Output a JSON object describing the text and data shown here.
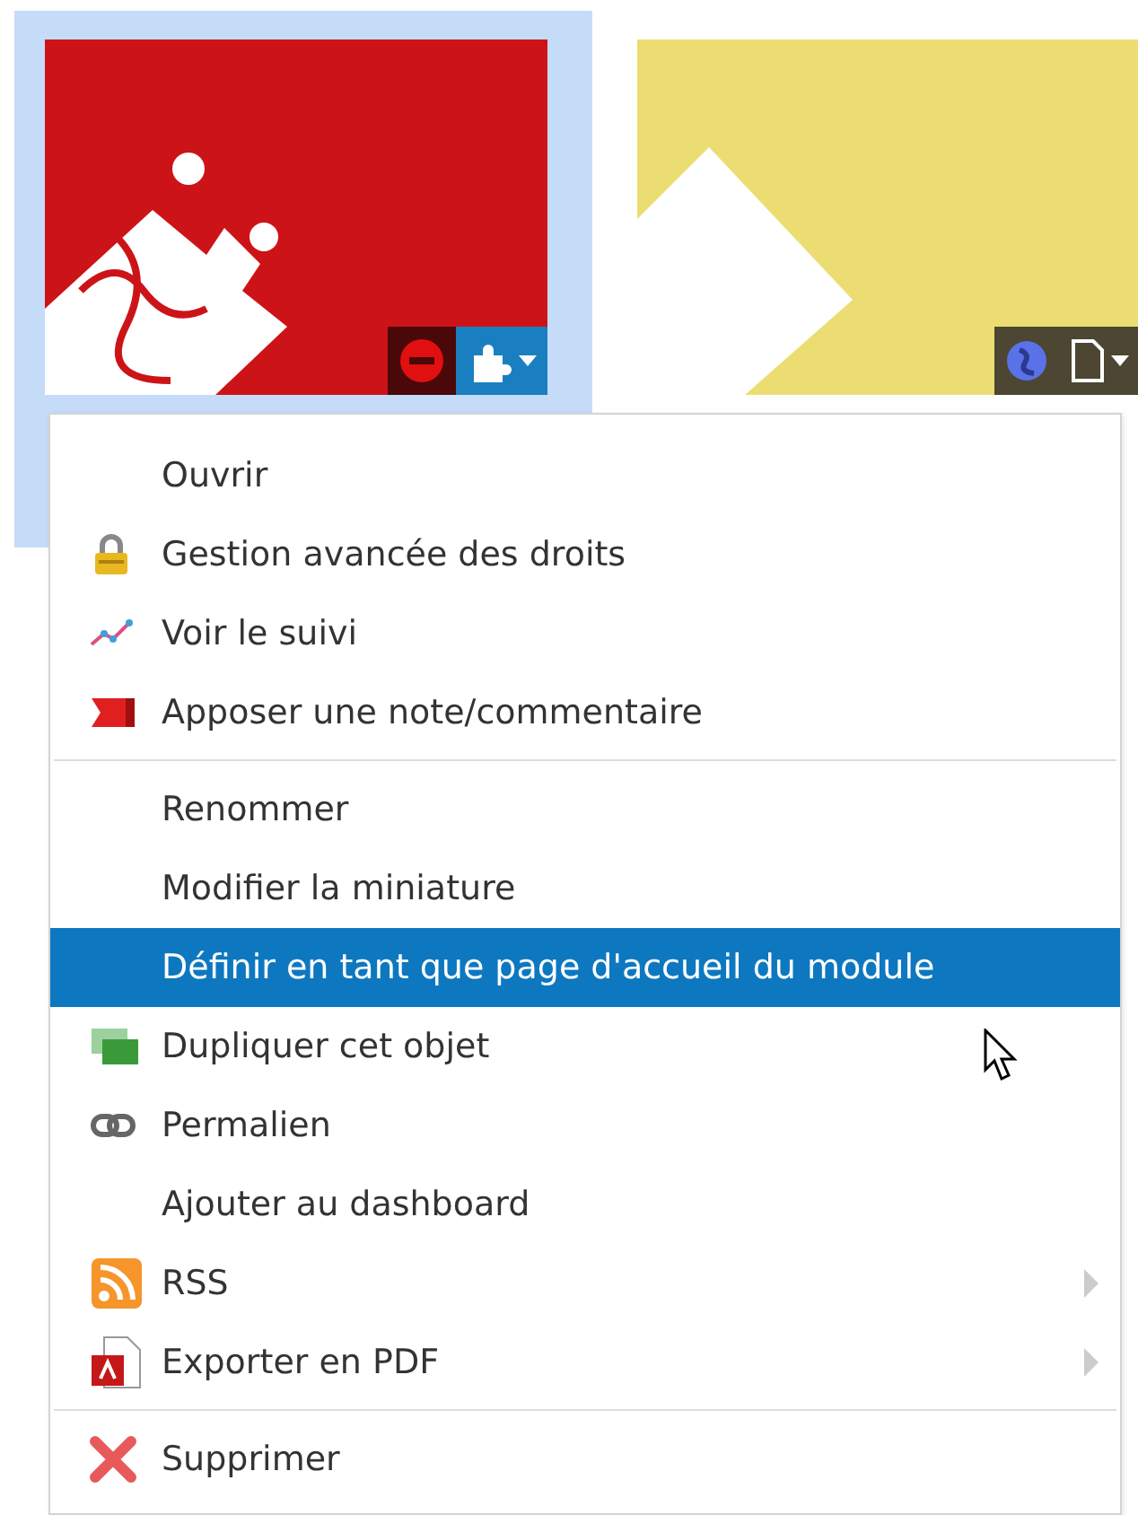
{
  "tiles": [
    {
      "kind": "puzzle",
      "selected": true
    },
    {
      "kind": "page",
      "selected": false
    }
  ],
  "menu": {
    "groups": [
      [
        {
          "label": "Ouvrir",
          "kind": "none",
          "selected": false,
          "submenu": false
        },
        {
          "label": "Gestion avancée des droits",
          "kind": "lock",
          "selected": false,
          "submenu": false
        },
        {
          "label": "Voir le suivi",
          "kind": "graph",
          "selected": false,
          "submenu": false
        },
        {
          "label": "Apposer une note/commentaire",
          "kind": "note",
          "selected": false,
          "submenu": false
        }
      ],
      [
        {
          "label": "Renommer",
          "kind": "none",
          "selected": false,
          "submenu": false
        },
        {
          "label": "Modifier la miniature",
          "kind": "none",
          "selected": false,
          "submenu": false
        },
        {
          "label": "Définir en tant que page d'accueil du module",
          "kind": "none",
          "selected": true,
          "submenu": false
        },
        {
          "label": "Dupliquer cet objet",
          "kind": "copy",
          "selected": false,
          "submenu": false
        },
        {
          "label": "Permalien",
          "kind": "link",
          "selected": false,
          "submenu": false
        },
        {
          "label": "Ajouter au dashboard",
          "kind": "none",
          "selected": false,
          "submenu": false
        },
        {
          "label": "RSS",
          "kind": "rss",
          "selected": false,
          "submenu": true
        },
        {
          "label": "Exporter en PDF",
          "kind": "pdf",
          "selected": false,
          "submenu": true
        }
      ],
      [
        {
          "label": "Supprimer",
          "kind": "delete",
          "selected": false,
          "submenu": false
        }
      ]
    ]
  }
}
